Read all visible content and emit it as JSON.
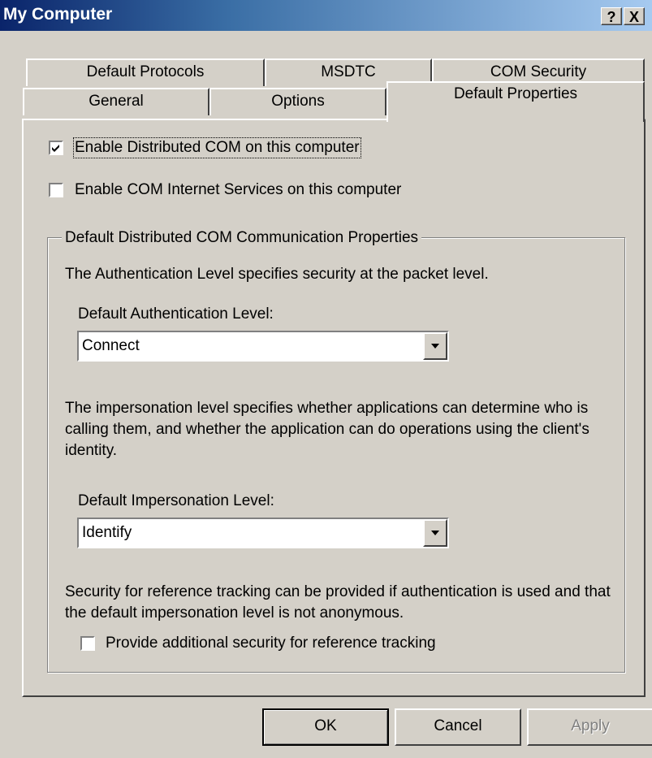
{
  "window": {
    "title": "My Computer",
    "help_button": "?",
    "close_button": "X"
  },
  "tabs": {
    "row1": [
      "Default Protocols",
      "MSDTC",
      "COM Security"
    ],
    "row2": [
      "General",
      "Options",
      "Default Properties"
    ],
    "active": "Default Properties"
  },
  "options": {
    "enable_dcom": {
      "label": "Enable Distributed COM on this computer",
      "checked": true
    },
    "enable_cis": {
      "label": "Enable COM Internet Services on this computer",
      "checked": false
    }
  },
  "group": {
    "title": "Default Distributed COM Communication Properties",
    "auth_description": "The Authentication Level specifies security at the packet level.",
    "auth_label": "Default Authentication Level:",
    "auth_value": "Connect",
    "imp_description": "The impersonation level specifies whether applications can determine who is calling them, and whether the application can do operations using the client's identity.",
    "imp_label": "Default Impersonation Level:",
    "imp_value": "Identify",
    "ref_description": "Security for reference tracking can be provided if authentication is used and that the default impersonation level is not anonymous.",
    "ref_checkbox": {
      "label": "Provide additional security for reference tracking",
      "checked": false
    }
  },
  "buttons": {
    "ok": "OK",
    "cancel": "Cancel",
    "apply": "Apply"
  }
}
